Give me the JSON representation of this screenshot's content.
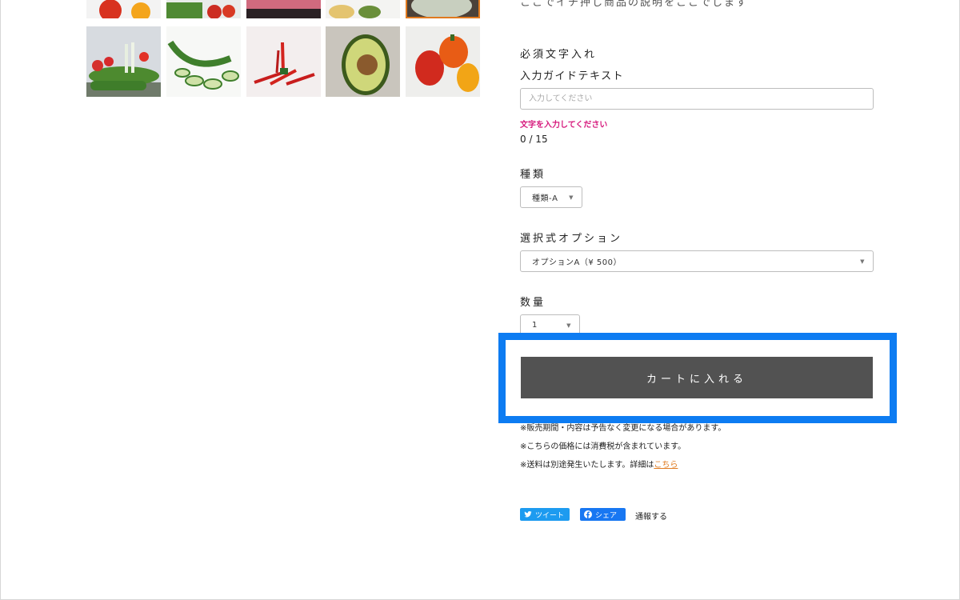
{
  "description_partial": "ここでイチ押し商品の説明をここでします",
  "gallery": {
    "thumbnails": [
      {
        "name": "tomato-pepper-top-thumb",
        "selected": false
      },
      {
        "name": "greens-tomato-top-thumb",
        "selected": false
      },
      {
        "name": "sunset-top-thumb",
        "selected": false
      },
      {
        "name": "potato-top-thumb",
        "selected": false
      },
      {
        "name": "cabbage-top-thumb",
        "selected": true
      },
      {
        "name": "vegetable-platter-thumb",
        "selected": false
      },
      {
        "name": "sliced-cucumber-thumb",
        "selected": false
      },
      {
        "name": "red-chili-thumb",
        "selected": false
      },
      {
        "name": "avocado-thumb",
        "selected": false
      },
      {
        "name": "bell-peppers-thumb",
        "selected": false
      }
    ]
  },
  "form": {
    "required_text_label": "必須文字入れ",
    "input_guide_label": "入力ガイドテキスト",
    "text_placeholder": "入力してください",
    "error_message": "文字を入力してください",
    "char_counter": "0 / 15",
    "type_label": "種類",
    "type_selected": "種類-A",
    "option_label": "選択式オプション",
    "option_selected": "オプションA（¥ 500）",
    "quantity_label": "数量",
    "quantity_selected": "1"
  },
  "cart_button_label": "カートに入れる",
  "highlight_color": "#0d7cf2",
  "notes": {
    "line1": "※販売期間・内容は予告なく変更になる場合があります。",
    "line2": "※こちらの価格には消費税が含まれています。",
    "line3_prefix": "※送料は別途発生いたします。詳細は",
    "line3_link": "こちら"
  },
  "social": {
    "tweet_label": "ツイート",
    "share_label": "シェア",
    "report_label": "通報する"
  }
}
